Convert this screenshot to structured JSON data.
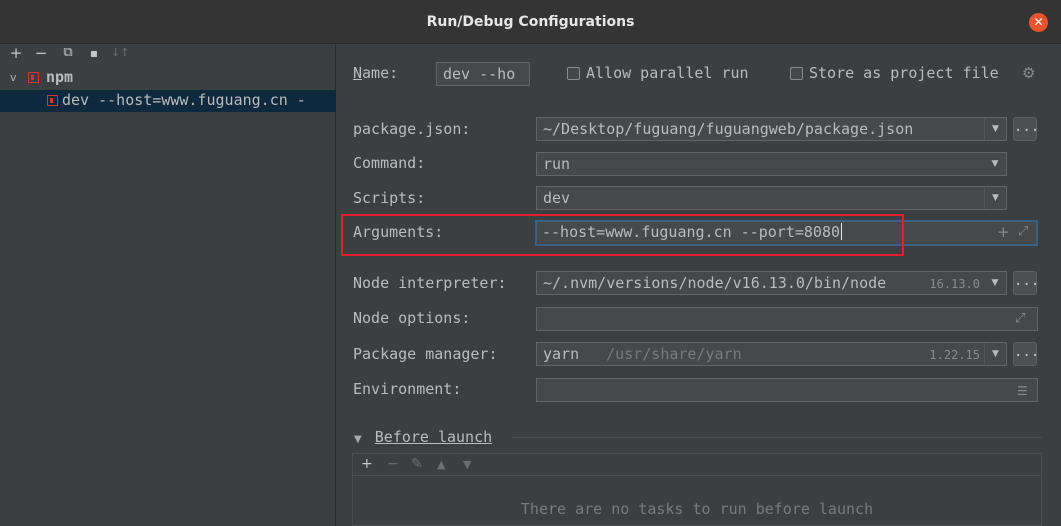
{
  "window": {
    "title": "Run/Debug Configurations",
    "close_label": "✕"
  },
  "left_toolbar": {
    "add": "+",
    "remove": "−",
    "copy": "⧉",
    "folder": "▪",
    "sort": "↓↑"
  },
  "tree": {
    "group_label": "npm",
    "group_chevron": "v",
    "item_label": "dev --host=www.fuguang.cn -"
  },
  "form": {
    "name_label": "Name:",
    "name_value": "dev --ho",
    "allow_parallel_label": "Allow parallel run",
    "allow_parallel_checked": false,
    "store_as_file_label": "Store as project file",
    "store_as_file_checked": false,
    "package_json_label": "package.json:",
    "package_json_value": "~/Desktop/fuguang/fuguangweb/package.json",
    "command_label": "Command:",
    "command_value": "run",
    "scripts_label": "Scripts:",
    "scripts_value": "dev",
    "arguments_label": "Arguments:",
    "arguments_value": "--host=www.fuguang.cn --port=8080",
    "node_interpreter_label": "Node interpreter:",
    "node_interpreter_value": "~/.nvm/versions/node/v16.13.0/bin/node",
    "node_interpreter_version": "16.13.0",
    "node_options_label": "Node options:",
    "node_options_value": "",
    "package_manager_label": "Package manager:",
    "package_manager_value": "yarn",
    "package_manager_path": "/usr/share/yarn",
    "package_manager_version": "1.22.15",
    "environment_label": "Environment:",
    "environment_value": "",
    "browse_label": "..."
  },
  "before_launch": {
    "title": "Before launch",
    "empty_message": "There are no tasks to run before launch"
  },
  "colors": {
    "highlight": "#e0202a",
    "selection": "#0d293e",
    "npm_red": "#cb3837"
  }
}
